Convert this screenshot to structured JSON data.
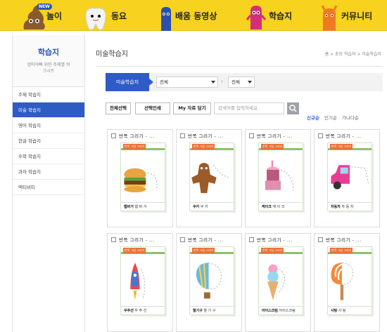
{
  "nav": {
    "items": [
      {
        "label": "놀이",
        "badge": "NEW"
      },
      {
        "label": "동요"
      },
      {
        "label": "배움 동영상"
      },
      {
        "label": "학습지"
      },
      {
        "label": "커뮤니티"
      }
    ]
  },
  "sidebar": {
    "title": "학습지",
    "desc": "엄마아빠 위한 주제별 워크시트",
    "items": [
      {
        "label": "주제 학습지",
        "active": false
      },
      {
        "label": "미술 학습지",
        "active": true
      },
      {
        "label": "영어 학습지",
        "active": false
      },
      {
        "label": "한글 학습지",
        "active": false
      },
      {
        "label": "수학 학습지",
        "active": false
      },
      {
        "label": "과자 학습지",
        "active": false
      },
      {
        "label": "액티비티",
        "active": false
      }
    ]
  },
  "main": {
    "title": "미술학습지",
    "breadcrumb": "홈 > 초등 학습지 > 미술학습지",
    "filter": {
      "tab": "미술학습지",
      "select1": "전체",
      "select2": "전체"
    },
    "buttons": {
      "select_all": "전체선택",
      "print_selected": "선택인쇄",
      "my_list": "My 자료 담기"
    },
    "search": {
      "placeholder": "검색어를 입력하세요."
    },
    "sort": [
      "신규순",
      "인기순",
      "가나다순"
    ]
  },
  "cards": [
    {
      "title": "반쪽 그리기 - ...",
      "tag": "반쪽 그림 그리기",
      "word_icon": "햄버거",
      "word": "햄 버 거",
      "pic": "hamburger"
    },
    {
      "title": "반쪽 그리기 - ...",
      "tag": "반쪽 그림 그리기",
      "word_icon": "쿠키",
      "word": "쿠 키",
      "pic": "cookie"
    },
    {
      "title": "반쪽 그리기 - ...",
      "tag": "반쪽 그림 그리기",
      "word_icon": "케이크",
      "word": "케 이 크",
      "pic": "cake"
    },
    {
      "title": "반쪽 그리기 - ...",
      "tag": "반쪽 그림 그리기",
      "word_icon": "자동차",
      "word": "자 동 차",
      "pic": "car"
    },
    {
      "title": "반쪽 그리기 - ...",
      "tag": "반쪽 그림 그리기",
      "word_icon": "우주선",
      "word": "우 주 선",
      "pic": "rocket"
    },
    {
      "title": "반쪽 그리기 - ...",
      "tag": "반쪽 그림 그리기",
      "word_icon": "열기구",
      "word": "열 기 구",
      "pic": "balloon"
    },
    {
      "title": "반쪽 그리기 - ...",
      "tag": "반쪽 그림 그리기",
      "word_icon": "아이스크림",
      "word": "아이스크림",
      "pic": "icecream"
    },
    {
      "title": "반쪽 그리기 - ...",
      "tag": "반쪽 그림 그리기",
      "word_icon": "사탕",
      "word": "사 탕",
      "pic": "candy"
    }
  ]
}
